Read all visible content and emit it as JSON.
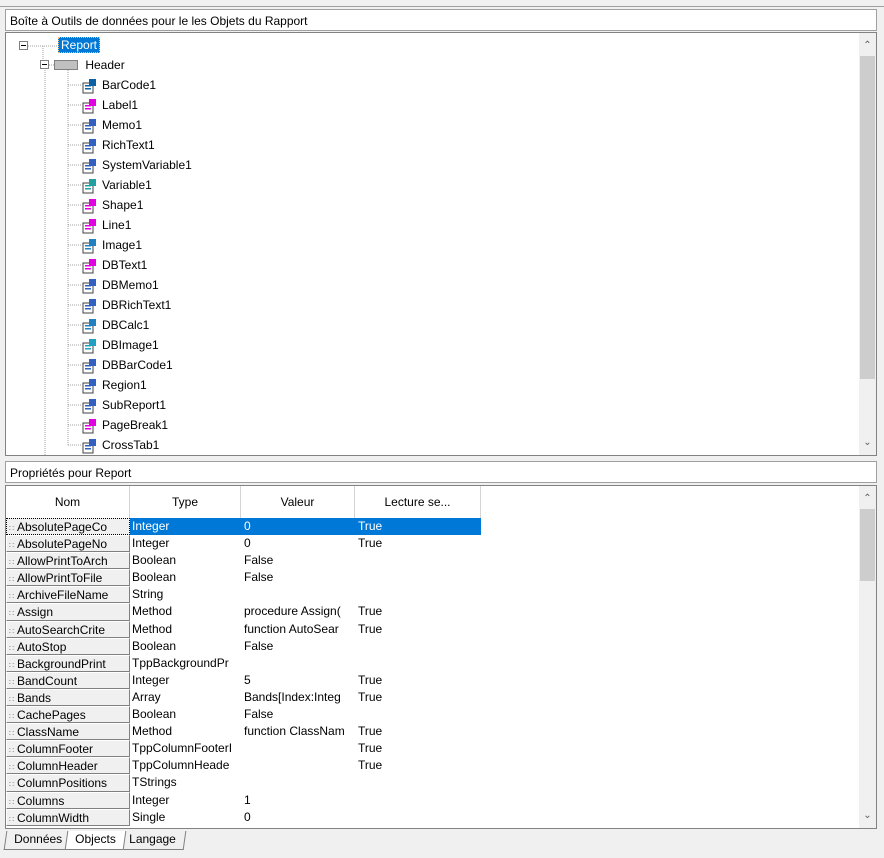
{
  "tree_panel": {
    "title": "Boîte à Outils de données pour le les Objets du Rapport",
    "root": "Report",
    "group": "Header",
    "items": [
      "BarCode1",
      "Label1",
      "Memo1",
      "RichText1",
      "SystemVariable1",
      "Variable1",
      "Shape1",
      "Line1",
      "Image1",
      "DBText1",
      "DBMemo1",
      "DBRichText1",
      "DBCalc1",
      "DBImage1",
      "DBBarCode1",
      "Region1",
      "SubReport1",
      "PageBreak1",
      "CrossTab1"
    ],
    "icons": [
      "barcode-icon",
      "label-icon",
      "memo-icon",
      "richtext-icon",
      "system-variable-icon",
      "variable-icon",
      "shape-icon",
      "line-icon",
      "image-icon",
      "dbtext-icon",
      "dbmemo-icon",
      "dbrichtext-icon",
      "dbcalc-icon",
      "dbimage-icon",
      "dbbarcode-icon",
      "region-icon",
      "subreport-icon",
      "pagebreak-icon",
      "crosstab-icon"
    ]
  },
  "props_panel": {
    "title": "Propriétés pour Report",
    "columns": [
      "Nom",
      "Type",
      "Valeur",
      "Lecture se..."
    ],
    "rows": [
      [
        "AbsolutePageCo",
        "Integer",
        "0",
        "True"
      ],
      [
        "AbsolutePageNo",
        "Integer",
        "0",
        "True"
      ],
      [
        "AllowPrintToArch",
        "Boolean",
        "False",
        ""
      ],
      [
        "AllowPrintToFile",
        "Boolean",
        "False",
        ""
      ],
      [
        "ArchiveFileName",
        "String",
        "",
        ""
      ],
      [
        "Assign",
        "Method",
        "procedure Assign(",
        "True"
      ],
      [
        "AutoSearchCrite",
        "Method",
        "function AutoSear",
        "True"
      ],
      [
        "AutoStop",
        "Boolean",
        "False",
        ""
      ],
      [
        "BackgroundPrint",
        "TppBackgroundPr",
        "",
        ""
      ],
      [
        "BandCount",
        "Integer",
        "5",
        "True"
      ],
      [
        "Bands",
        "Array",
        "Bands[Index:Integ",
        "True"
      ],
      [
        "CachePages",
        "Boolean",
        "False",
        ""
      ],
      [
        "ClassName",
        "Method",
        "function ClassNam",
        "True"
      ],
      [
        "ColumnFooter",
        "TppColumnFooterI",
        "",
        "True"
      ],
      [
        "ColumnHeader",
        "TppColumnHeade",
        "",
        "True"
      ],
      [
        "ColumnPositions",
        "TStrings",
        "",
        ""
      ],
      [
        "Columns",
        "Integer",
        "1",
        ""
      ],
      [
        "ColumnWidth",
        "Single",
        "0",
        ""
      ]
    ]
  },
  "tabs": [
    "Données",
    "Objects",
    "Langage"
  ],
  "colors": {
    "selection": "#0078d7",
    "background": "#f0f0f0"
  }
}
